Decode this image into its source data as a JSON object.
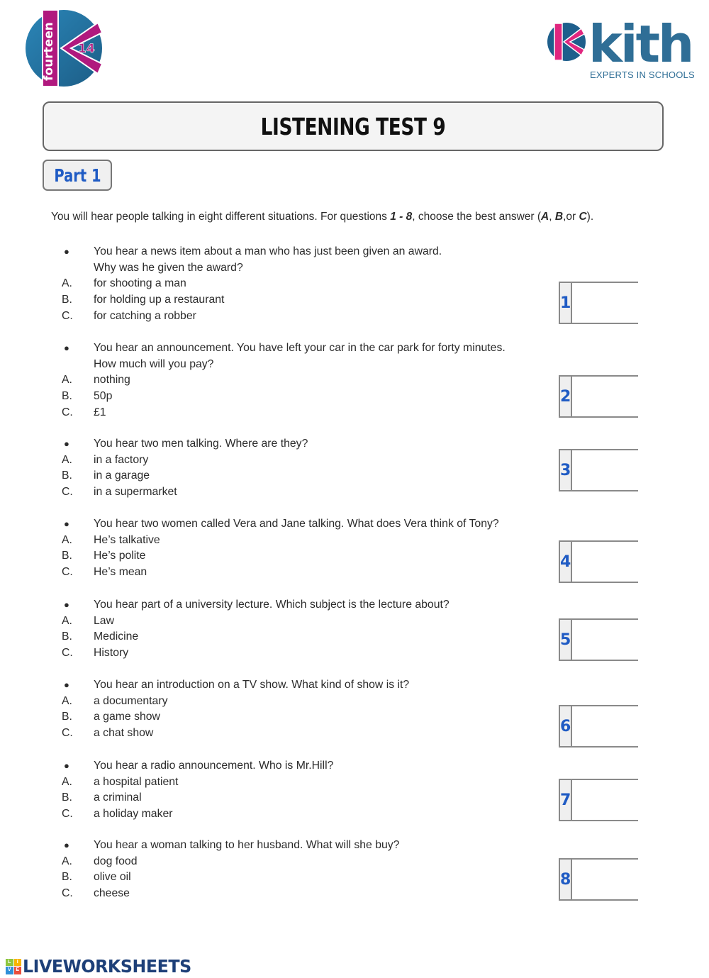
{
  "logos": {
    "left": {
      "text": "fourteen",
      "number": "14"
    },
    "right": {
      "word": "kith",
      "tagline": "EXPERTS IN SCHOOLS"
    }
  },
  "title": "LISTENING TEST 9",
  "part_label": "Part 1",
  "intro": {
    "before": "You will hear people talking in eight different situations. For questions ",
    "range": "1 - 8",
    "middle": ", choose the best answer (",
    "opt_a": "A",
    "sep1": ", ",
    "opt_b": "B",
    "sep2": ",or ",
    "opt_c": "C",
    "after": ")."
  },
  "questions": [
    {
      "number": "1",
      "prompt_lines": [
        "You hear a news item about a man who has just been given an award.",
        "Why was he given the award?"
      ],
      "options": [
        {
          "letter": "A.",
          "text": "for shooting a man"
        },
        {
          "letter": "B.",
          "text": "for holding up a restaurant"
        },
        {
          "letter": "C.",
          "text": "for catching a robber"
        }
      ],
      "answer": ""
    },
    {
      "number": "2",
      "prompt_lines": [
        "You hear an announcement. You have left your car in the car park for forty minutes.",
        "How much will you pay?"
      ],
      "options": [
        {
          "letter": "A.",
          "text": "nothing"
        },
        {
          "letter": "B.",
          "text": "50p"
        },
        {
          "letter": "C.",
          "text": "£1"
        }
      ],
      "answer": ""
    },
    {
      "number": "3",
      "prompt_lines": [
        "You hear two men talking. Where are they?"
      ],
      "options": [
        {
          "letter": "A.",
          "text": "in a factory"
        },
        {
          "letter": "B.",
          "text": "in a garage"
        },
        {
          "letter": "C.",
          "text": "in a supermarket"
        }
      ],
      "answer": ""
    },
    {
      "number": "4",
      "prompt_lines": [
        "You hear two women called Vera and Jane talking. What does Vera think of Tony?"
      ],
      "options": [
        {
          "letter": "A.",
          "text": "He’s talkative"
        },
        {
          "letter": "B.",
          "text": "He’s polite"
        },
        {
          "letter": "C.",
          "text": "He’s mean"
        }
      ],
      "answer": ""
    },
    {
      "number": "5",
      "prompt_lines": [
        "You hear part of a university lecture. Which subject is the lecture about?"
      ],
      "options": [
        {
          "letter": "A.",
          "text": "Law"
        },
        {
          "letter": "B.",
          "text": "Medicine"
        },
        {
          "letter": "C.",
          "text": "History"
        }
      ],
      "answer": ""
    },
    {
      "number": "6",
      "prompt_lines": [
        "You hear an introduction on a TV show. What kind of show is it?"
      ],
      "options": [
        {
          "letter": "A.",
          "text": "a documentary"
        },
        {
          "letter": "B.",
          "text": "a game show"
        },
        {
          "letter": "C.",
          "text": "a chat show"
        }
      ],
      "answer": ""
    },
    {
      "number": "7",
      "prompt_lines": [
        "You hear a radio announcement. Who is Mr.Hill?"
      ],
      "options": [
        {
          "letter": "A.",
          "text": "a hospital patient"
        },
        {
          "letter": "B.",
          "text": "a criminal"
        },
        {
          "letter": "C.",
          "text": "a holiday maker"
        }
      ],
      "answer": ""
    },
    {
      "number": "8",
      "prompt_lines": [
        "You hear a woman talking to her husband. What will she buy?"
      ],
      "options": [
        {
          "letter": "A.",
          "text": "dog food"
        },
        {
          "letter": "B.",
          "text": "olive oil"
        },
        {
          "letter": "C.",
          "text": "cheese"
        }
      ],
      "answer": ""
    }
  ],
  "bullet_glyph": "●",
  "footer": {
    "brand": "LIVEWORKSHEETS",
    "icon_letters": [
      "L",
      "I",
      "V",
      "E"
    ]
  },
  "colors": {
    "accent_blue": "#1f5bc4",
    "brand_blue": "#2f6e96",
    "brand_magenta": "#b0197e",
    "footer_navy": "#1d3f78"
  }
}
